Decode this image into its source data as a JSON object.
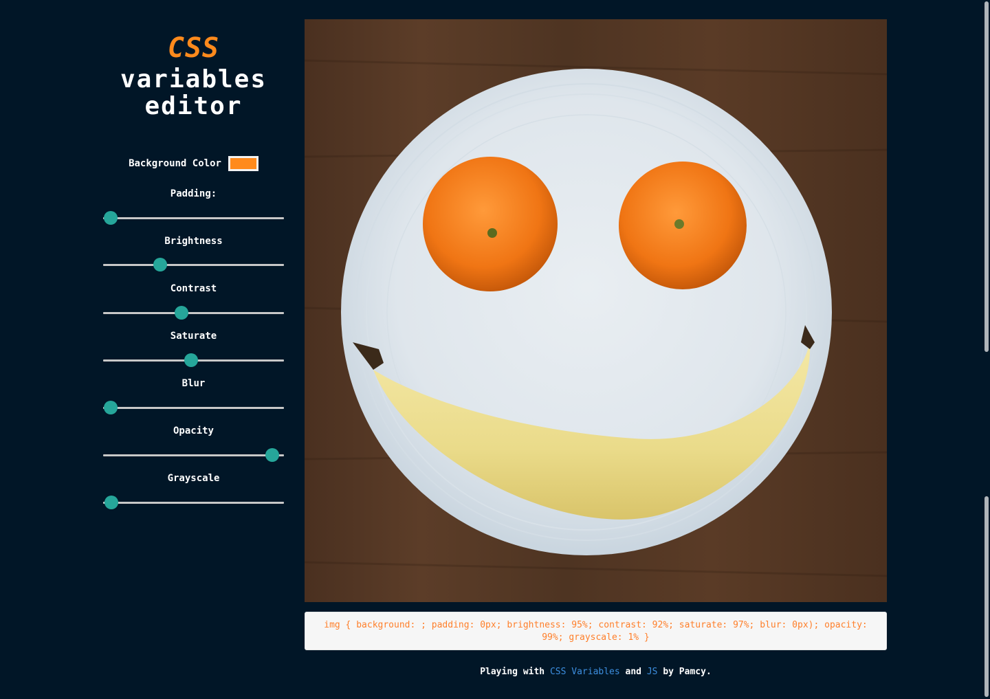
{
  "title": {
    "accent": "CSS",
    "rest": "variables\neditor"
  },
  "controls": {
    "background_color": {
      "label": "Background Color",
      "value": "#ff8a1c"
    },
    "sliders": [
      {
        "label": "Padding:",
        "value": 0.04
      },
      {
        "label": "Brightness",
        "value": 0.315
      },
      {
        "label": "Contrast",
        "value": 0.435
      },
      {
        "label": "Saturate",
        "value": 0.485
      },
      {
        "label": "Blur",
        "value": 0.04
      },
      {
        "label": "Opacity",
        "value": 0.935
      },
      {
        "label": "Grayscale",
        "value": 0.045
      }
    ]
  },
  "css_output": "img { background: ; padding: 0px; brightness: 95%; contrast: 92%; saturate: 97%; blur: 0px); opacity: 99%; grayscale: 1% }",
  "footer": {
    "prefix": "Playing with",
    "link1": "CSS Variables",
    "middle": "and",
    "link2": "JS",
    "suffix": "by Pamcy."
  },
  "colors": {
    "background": "#011627",
    "accent": "#ff8a1c",
    "slider_thumb": "#26a69a",
    "link": "#3d8fe0"
  },
  "icons": {
    "photo": "smiley-fruit-plate-image"
  }
}
